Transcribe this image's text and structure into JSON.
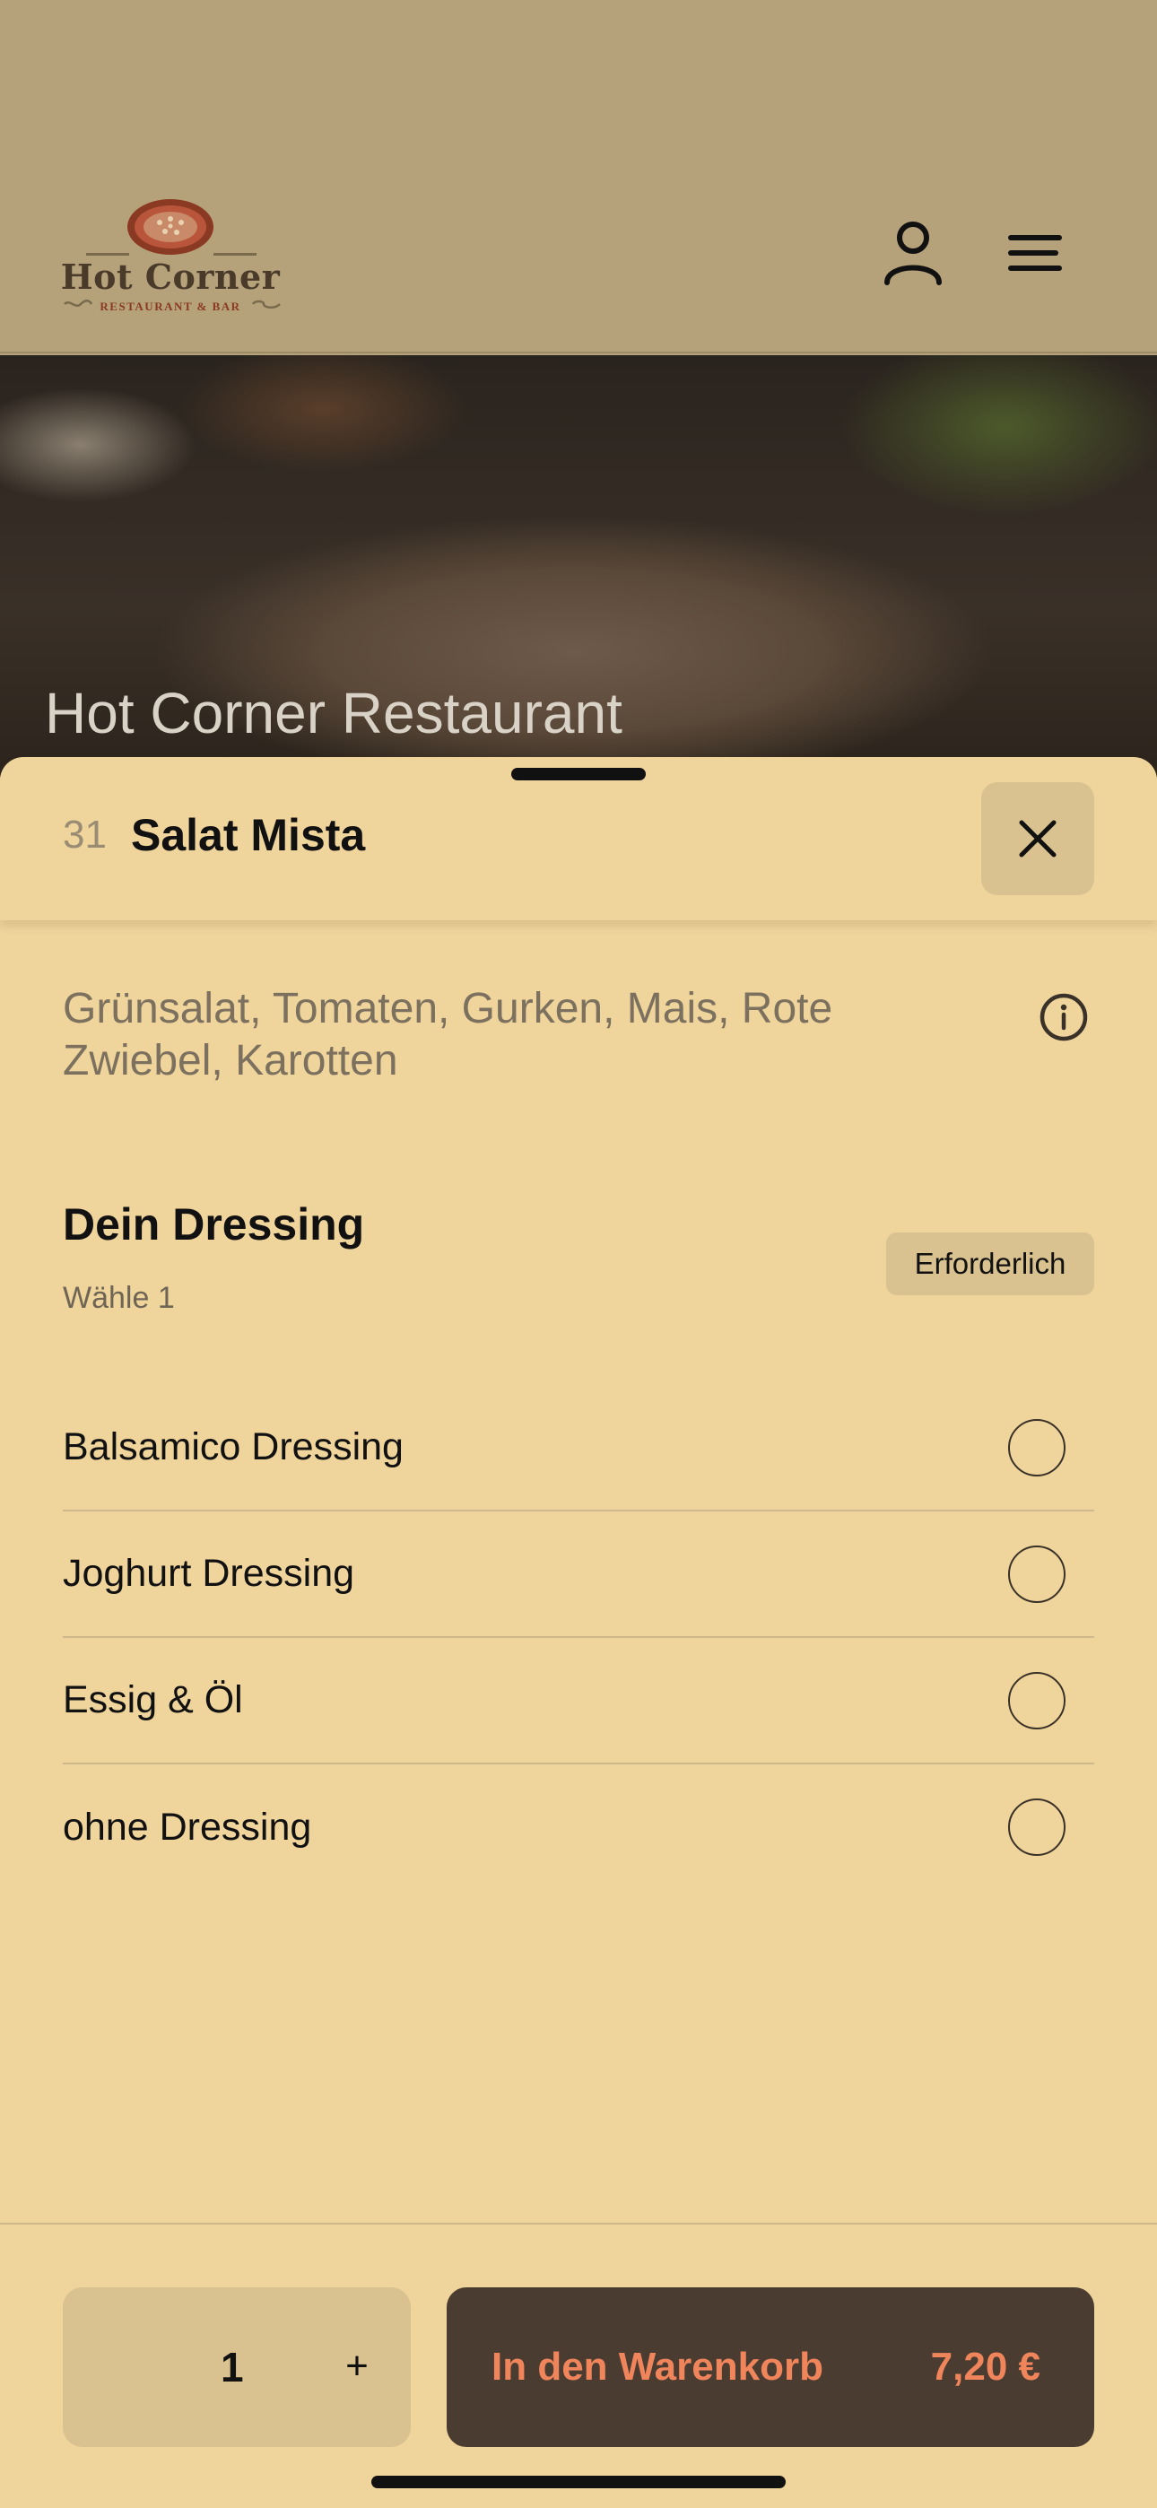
{
  "brand": {
    "name": "Hot Corner",
    "tagline": "RESTAURANT & BAR"
  },
  "header": {
    "icons": [
      "user-icon",
      "menu-icon"
    ]
  },
  "hero": {
    "title": "Hot Corner Restaurant"
  },
  "item": {
    "number": "31",
    "title": "Salat Mista",
    "description": "Grünsalat, Tomaten, Gurken, Mais, Rote Zwiebel, Karotten"
  },
  "dressing": {
    "title": "Dein Dressing",
    "subtitle": "Wähle 1",
    "badge": "Erforderlich",
    "options": [
      {
        "label": "Balsamico Dressing",
        "selected": false
      },
      {
        "label": "Joghurt Dressing",
        "selected": false
      },
      {
        "label": "Essig & Öl",
        "selected": false
      },
      {
        "label": "ohne Dressing",
        "selected": false
      }
    ]
  },
  "footer": {
    "quantity": "1",
    "plus": "+",
    "cart_label": "In den Warenkorb",
    "price": "7,20 €"
  },
  "colors": {
    "header_bg": "#b5a27a",
    "sheet_bg": "#efd49c",
    "button_bg": "#d9c290",
    "cart_bg": "#4a3c30",
    "cart_text": "#f0855c"
  }
}
